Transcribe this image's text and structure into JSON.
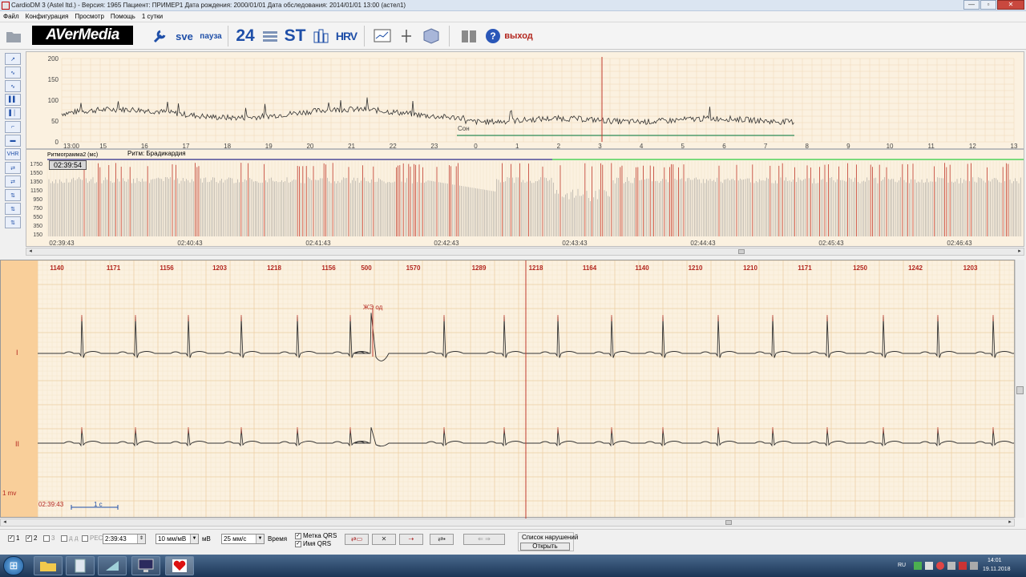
{
  "window": {
    "title": "CardioDM 3 (Astel ltd.) - Версия: 1965  Пациент: ПРИМЕР1   Дата рождения: 2000/01/01  Дата обследования: 2014/01/01 13:00 (астел1)",
    "buttons": [
      "—",
      "▫",
      "✕"
    ]
  },
  "menu": [
    "Файл",
    "Конфигурация",
    "Просмотр",
    "Помощь",
    "1 сутки"
  ],
  "toolbar": {
    "logo": "AVerMedia",
    "b24": "24",
    "st": "ST",
    "hrv": "HRV",
    "exit": "выход",
    "sve": "sve",
    "pause": "пауза"
  },
  "left_tools": [
    "↗",
    "∿",
    "∿",
    "▌▌",
    "▌│",
    "⌐",
    "▬",
    "VHR",
    "⇄",
    "⇄",
    "⇅",
    "⇅",
    "⇅"
  ],
  "trend": {
    "y_ticks": [
      "200",
      "150",
      "100",
      "50",
      "0"
    ],
    "x_ticks": [
      "13:00",
      "15",
      "16",
      "17",
      "18",
      "19",
      "20",
      "21",
      "22",
      "23",
      "0",
      "1",
      "2",
      "3",
      "4",
      "5",
      "6",
      "7",
      "8",
      "9",
      "10",
      "11",
      "12",
      "13"
    ],
    "sleep_label": "Сон"
  },
  "rhythm": {
    "header": "Ритмограмма2  (мс)",
    "rhythm_label": "Ритм:  Брадикардия",
    "cursor_time": "02:39:54",
    "y_ticks": [
      "1750",
      "1550",
      "1350",
      "1150",
      "950",
      "750",
      "550",
      "350",
      "150"
    ],
    "x_ticks": [
      "02:39:43",
      "02:40:43",
      "02:41:43",
      "02:42:43",
      "02:43:43",
      "02:44:43",
      "02:45:43",
      "02:46:43"
    ]
  },
  "ecg": {
    "rr": [
      "1140",
      "1171",
      "1156",
      "1203",
      "1218",
      "1156",
      "500",
      "1570",
      "1289",
      "1218",
      "1164",
      "1140",
      "1210",
      "1210",
      "1171",
      "1250",
      "1242",
      "1203"
    ],
    "annotation": "ЖЭ од",
    "leads": [
      "I",
      "II"
    ],
    "mv_label": "1 mv",
    "time_label": "02:39:43",
    "scale_label": "1 с"
  },
  "bottom": {
    "ch1": "1",
    "ch2": "2",
    "ch3": "3",
    "ch4": "д д",
    "ch5": "РЕС",
    "time_value": "2:39:43",
    "gain": "10 мм/мВ",
    "gain_unit": "мВ",
    "speed": "25 мм/с",
    "time_text": "Время",
    "qrs_mark": "Метка QRS",
    "qrs_name": "Имя QRS",
    "events_title": "Список нарушений",
    "events_open": "Открыть"
  },
  "taskbar": {
    "lang": "RU",
    "time": "14:01",
    "date": "19.11.2018"
  },
  "colors": {
    "grid_bg": "#fbf1e0",
    "grid_line": "#f0d8b8",
    "trace": "#333333",
    "marker": "#c0392b",
    "accent": "#1f4fa8"
  }
}
